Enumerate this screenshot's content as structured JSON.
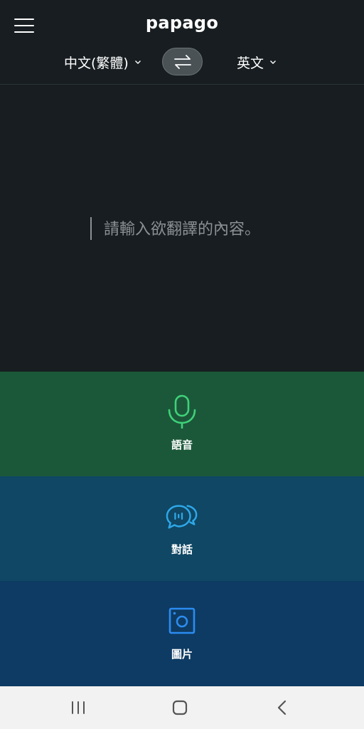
{
  "app": {
    "title": "papago"
  },
  "header": {
    "source_lang": "中文(繁體)",
    "target_lang": "英文"
  },
  "input": {
    "placeholder": "請輸入欲翻譯的內容。"
  },
  "modes": [
    {
      "label": "語音",
      "icon": "microphone-icon",
      "color": "#1b5839",
      "accent": "#3fd27a"
    },
    {
      "label": "對話",
      "icon": "conversation-icon",
      "color": "#0f4764",
      "accent": "#2ea7e8"
    },
    {
      "label": "圖片",
      "icon": "camera-icon",
      "color": "#0e3b63",
      "accent": "#2b8cf0"
    }
  ],
  "system_nav": {
    "recents_icon": "recents-icon",
    "home_icon": "home-icon",
    "back_icon": "back-icon"
  }
}
